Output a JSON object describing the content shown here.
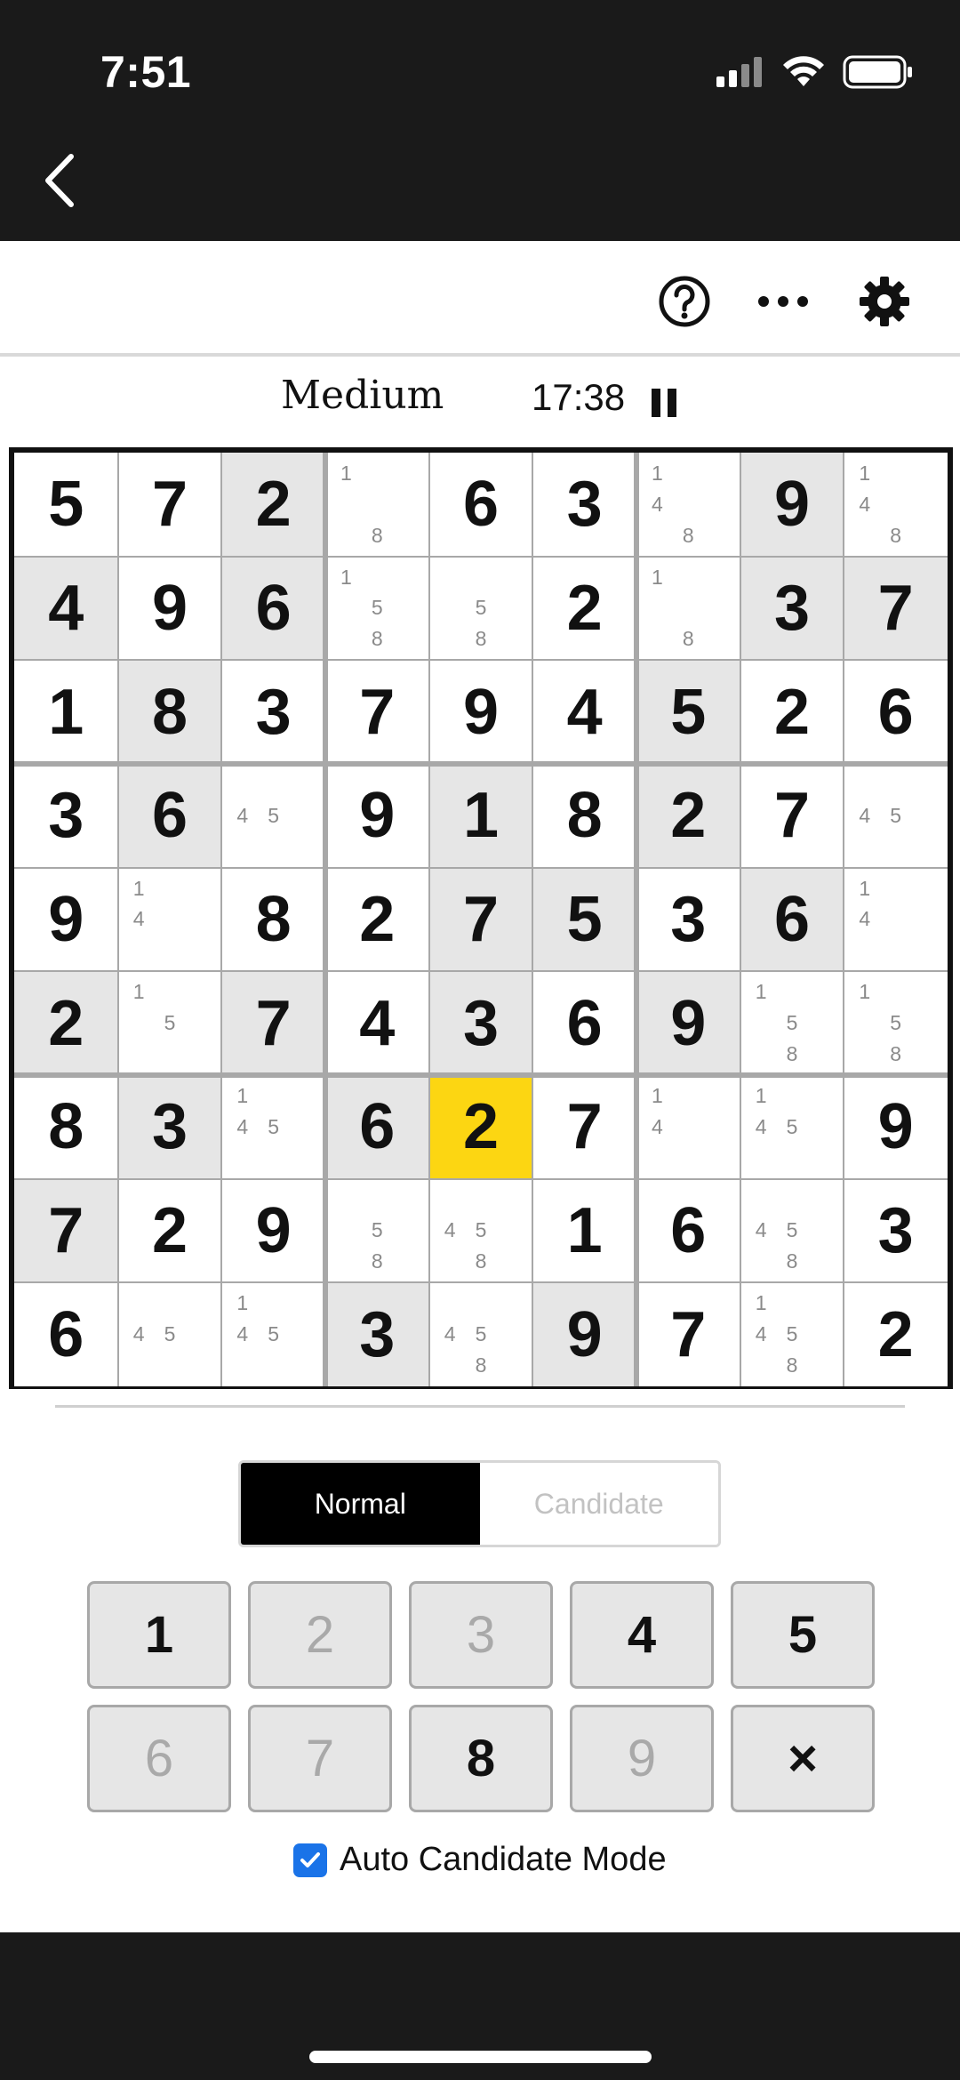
{
  "status_bar": {
    "time": "7:51",
    "icons": [
      "cellular-signal-icon",
      "wifi-icon",
      "battery-icon"
    ]
  },
  "nav": {
    "back_icon": "chevron-left-icon"
  },
  "toolbar": {
    "help_icon": "question-circle-icon",
    "more_icon": "ellipsis-icon",
    "settings_icon": "gear-icon"
  },
  "game": {
    "difficulty": "Medium",
    "timer": "17:38",
    "pause_icon": "pause-icon"
  },
  "board": {
    "rows": [
      [
        {
          "v": "5"
        },
        {
          "v": "7"
        },
        {
          "v": "2",
          "shade": true
        },
        {
          "c": [
            "1",
            "8"
          ]
        },
        {
          "v": "6"
        },
        {
          "v": "3"
        },
        {
          "c": [
            "1",
            "4",
            "8"
          ]
        },
        {
          "v": "9",
          "shade": true
        },
        {
          "c": [
            "1",
            "4",
            "8"
          ]
        }
      ],
      [
        {
          "v": "4",
          "shade": true
        },
        {
          "v": "9"
        },
        {
          "v": "6",
          "shade": true
        },
        {
          "c": [
            "1",
            "5",
            "8"
          ]
        },
        {
          "c": [
            "5",
            "8"
          ]
        },
        {
          "v": "2"
        },
        {
          "c": [
            "1",
            "8"
          ]
        },
        {
          "v": "3",
          "shade": true
        },
        {
          "v": "7",
          "shade": true
        }
      ],
      [
        {
          "v": "1"
        },
        {
          "v": "8",
          "shade": true
        },
        {
          "v": "3"
        },
        {
          "v": "7"
        },
        {
          "v": "9"
        },
        {
          "v": "4"
        },
        {
          "v": "5",
          "shade": true
        },
        {
          "v": "2"
        },
        {
          "v": "6"
        }
      ],
      [
        {
          "v": "3"
        },
        {
          "v": "6",
          "shade": true
        },
        {
          "c": [
            "4",
            "5"
          ]
        },
        {
          "v": "9"
        },
        {
          "v": "1",
          "shade": true
        },
        {
          "v": "8"
        },
        {
          "v": "2",
          "shade": true
        },
        {
          "v": "7"
        },
        {
          "c": [
            "4",
            "5"
          ]
        }
      ],
      [
        {
          "v": "9"
        },
        {
          "c": [
            "1",
            "4"
          ]
        },
        {
          "v": "8"
        },
        {
          "v": "2"
        },
        {
          "v": "7",
          "shade": true
        },
        {
          "v": "5",
          "shade": true
        },
        {
          "v": "3"
        },
        {
          "v": "6",
          "shade": true
        },
        {
          "c": [
            "1",
            "4"
          ]
        }
      ],
      [
        {
          "v": "2",
          "shade": true
        },
        {
          "c": [
            "1",
            "5"
          ]
        },
        {
          "v": "7",
          "shade": true
        },
        {
          "v": "4"
        },
        {
          "v": "3",
          "shade": true
        },
        {
          "v": "6"
        },
        {
          "v": "9",
          "shade": true
        },
        {
          "c": [
            "1",
            "5",
            "8"
          ]
        },
        {
          "c": [
            "1",
            "5",
            "8"
          ]
        }
      ],
      [
        {
          "v": "8"
        },
        {
          "v": "3",
          "shade": true
        },
        {
          "c": [
            "1",
            "4",
            "5"
          ]
        },
        {
          "v": "6",
          "shade": true
        },
        {
          "v": "2",
          "selected": true
        },
        {
          "v": "7"
        },
        {
          "c": [
            "1",
            "4"
          ]
        },
        {
          "c": [
            "1",
            "4",
            "5"
          ]
        },
        {
          "v": "9"
        }
      ],
      [
        {
          "v": "7",
          "shade": true
        },
        {
          "v": "2"
        },
        {
          "v": "9"
        },
        {
          "c": [
            "5",
            "8"
          ]
        },
        {
          "c": [
            "4",
            "5",
            "8"
          ]
        },
        {
          "v": "1"
        },
        {
          "v": "6"
        },
        {
          "c": [
            "4",
            "5",
            "8"
          ]
        },
        {
          "v": "3"
        }
      ],
      [
        {
          "v": "6"
        },
        {
          "c": [
            "4",
            "5"
          ]
        },
        {
          "c": [
            "1",
            "4",
            "5"
          ]
        },
        {
          "v": "3",
          "shade": true
        },
        {
          "c": [
            "4",
            "5",
            "8"
          ]
        },
        {
          "v": "9",
          "shade": true
        },
        {
          "v": "7"
        },
        {
          "c": [
            "1",
            "4",
            "5",
            "8"
          ]
        },
        {
          "v": "2"
        }
      ]
    ]
  },
  "mode": {
    "normal_label": "Normal",
    "candidate_label": "Candidate",
    "active": "Normal"
  },
  "keypad": {
    "keys": [
      {
        "label": "1",
        "enabled": true
      },
      {
        "label": "2",
        "enabled": false
      },
      {
        "label": "3",
        "enabled": false
      },
      {
        "label": "4",
        "enabled": true
      },
      {
        "label": "5",
        "enabled": true
      },
      {
        "label": "6",
        "enabled": false
      },
      {
        "label": "7",
        "enabled": false
      },
      {
        "label": "8",
        "enabled": true
      },
      {
        "label": "9",
        "enabled": false
      },
      {
        "label": "×",
        "enabled": true
      }
    ]
  },
  "auto_candidate": {
    "label": "Auto Candidate Mode",
    "checked": true
  },
  "colors": {
    "selected": "#fcd612",
    "shaded": "#e6e6e6",
    "checkbox": "#1a73e8"
  }
}
